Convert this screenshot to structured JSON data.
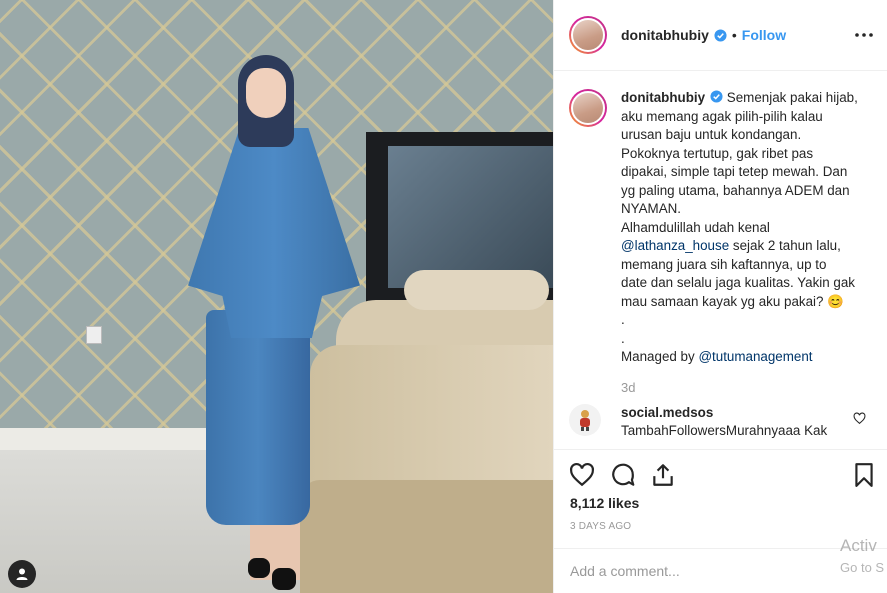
{
  "post": {
    "username": "donitabhubiy",
    "follow_label": "Follow",
    "separator": "•",
    "caption_lines": [
      "Semenjak pakai hijab,",
      "aku memang agak pilih-pilih kalau",
      "urusan baju untuk kondangan.",
      "Pokoknya tertutup, gak ribet pas",
      "dipakai, simple tapi tetep mewah. Dan",
      "yg paling utama, bahannya ADEM dan",
      "NYAMAN.",
      "Alhamdulillah udah kenal",
      "@lathanza_house",
      "sejak 2 tahun lalu,",
      "memang juara sih kaftannya, up to",
      "date dan selalu jaga kualitas. Yakin gak",
      "mau samaan kayak yg aku pakai? 😊",
      ".",
      ".",
      "Managed by",
      "@tutumanagement"
    ],
    "time_ago": "3d",
    "likes": "8,112 likes",
    "date": "3 DAYS AGO"
  },
  "comment": {
    "username": "social.medsos",
    "text": "TambahFollowersMurahnyaaa Kak"
  },
  "add_comment": {
    "placeholder": "Add a comment..."
  },
  "watermark": {
    "line1": "Activ",
    "line2": "Go to S"
  },
  "icons": {
    "verified": "verified-badge-icon",
    "more": "more-options-icon",
    "like": "heart-icon",
    "comment": "comment-icon",
    "share": "share-icon",
    "save": "bookmark-icon",
    "tag": "user-tag-icon"
  },
  "colors": {
    "link": "#3897f0",
    "mention": "#003569",
    "text": "#262626",
    "muted": "#999999"
  }
}
